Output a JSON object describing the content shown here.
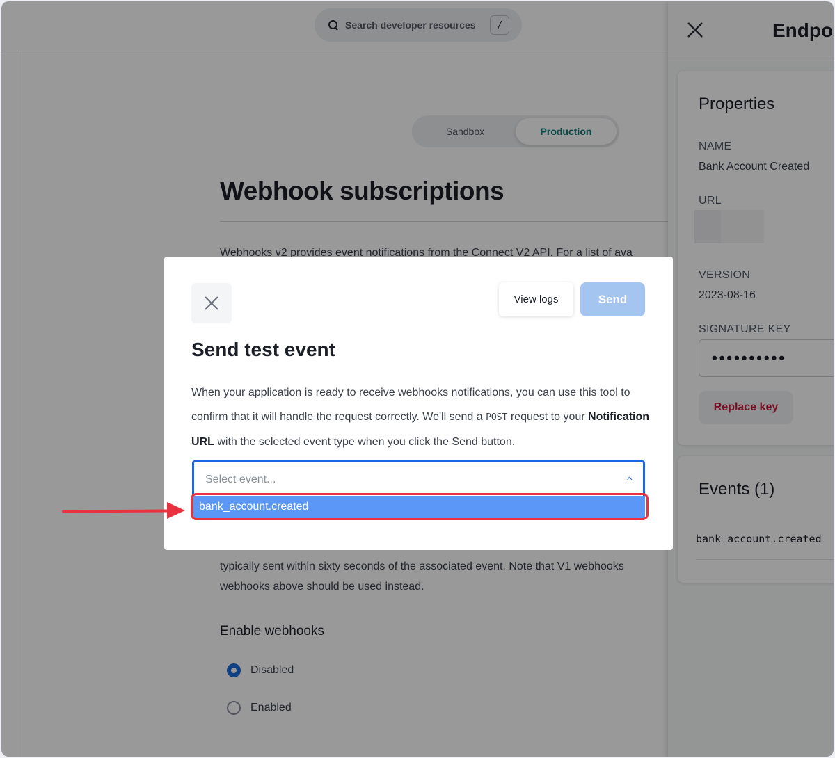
{
  "topbar": {
    "search_placeholder": "Search developer resources",
    "search_shortcut": "/",
    "search_icon": "search-icon"
  },
  "page": {
    "environment_tabs": [
      {
        "label": "Sandbox",
        "active": false
      },
      {
        "label": "Production",
        "active": true
      }
    ],
    "title": "Webhook subscriptions",
    "intro": "Webhooks v2 provides event notifications from the Connect V2 API. For a list of ava",
    "v1_note_line1": "typically sent within sixty seconds of the associated event. Note that V1 webhooks",
    "v1_note_line2": "webhooks above should be used instead.",
    "enable_section": {
      "title": "Enable webhooks",
      "options": [
        {
          "label": "Disabled",
          "checked": true
        },
        {
          "label": "Enabled",
          "checked": false
        }
      ]
    }
  },
  "side_panel": {
    "title": "Endpo",
    "close_icon": "close-icon",
    "properties": {
      "title": "Properties",
      "name_label": "NAME",
      "name_value": "Bank Account Created",
      "url_label": "URL",
      "version_label": "VERSION",
      "version_value": "2023-08-16",
      "signature_key_label": "SIGNATURE KEY",
      "signature_key_value": "••••••••••",
      "replace_key_label": "Replace key"
    },
    "events": {
      "title": "Events (1)",
      "items": [
        "bank_account.created"
      ]
    }
  },
  "modal": {
    "title": "Send test event",
    "view_logs_label": "View logs",
    "send_label": "Send",
    "description": {
      "part1": "When your application is ready to receive webhooks notifications, you can use this tool to confirm that it will handle the request correctly. We'll send a ",
      "method": "POST",
      "part2": " request to your ",
      "bold": "Notification URL",
      "part3": " with the selected event type when you click the Send button."
    },
    "select": {
      "placeholder": "Select event...",
      "options": [
        "bank_account.created"
      ],
      "highlighted": "bank_account.created"
    }
  },
  "colors": {
    "primary": "#1a66e0",
    "send_disabled": "#a4c5ef",
    "option_highlight": "#5a97f7",
    "annotation_red": "#e8323f",
    "production_teal": "#0e7c74",
    "danger": "#c8173f"
  }
}
